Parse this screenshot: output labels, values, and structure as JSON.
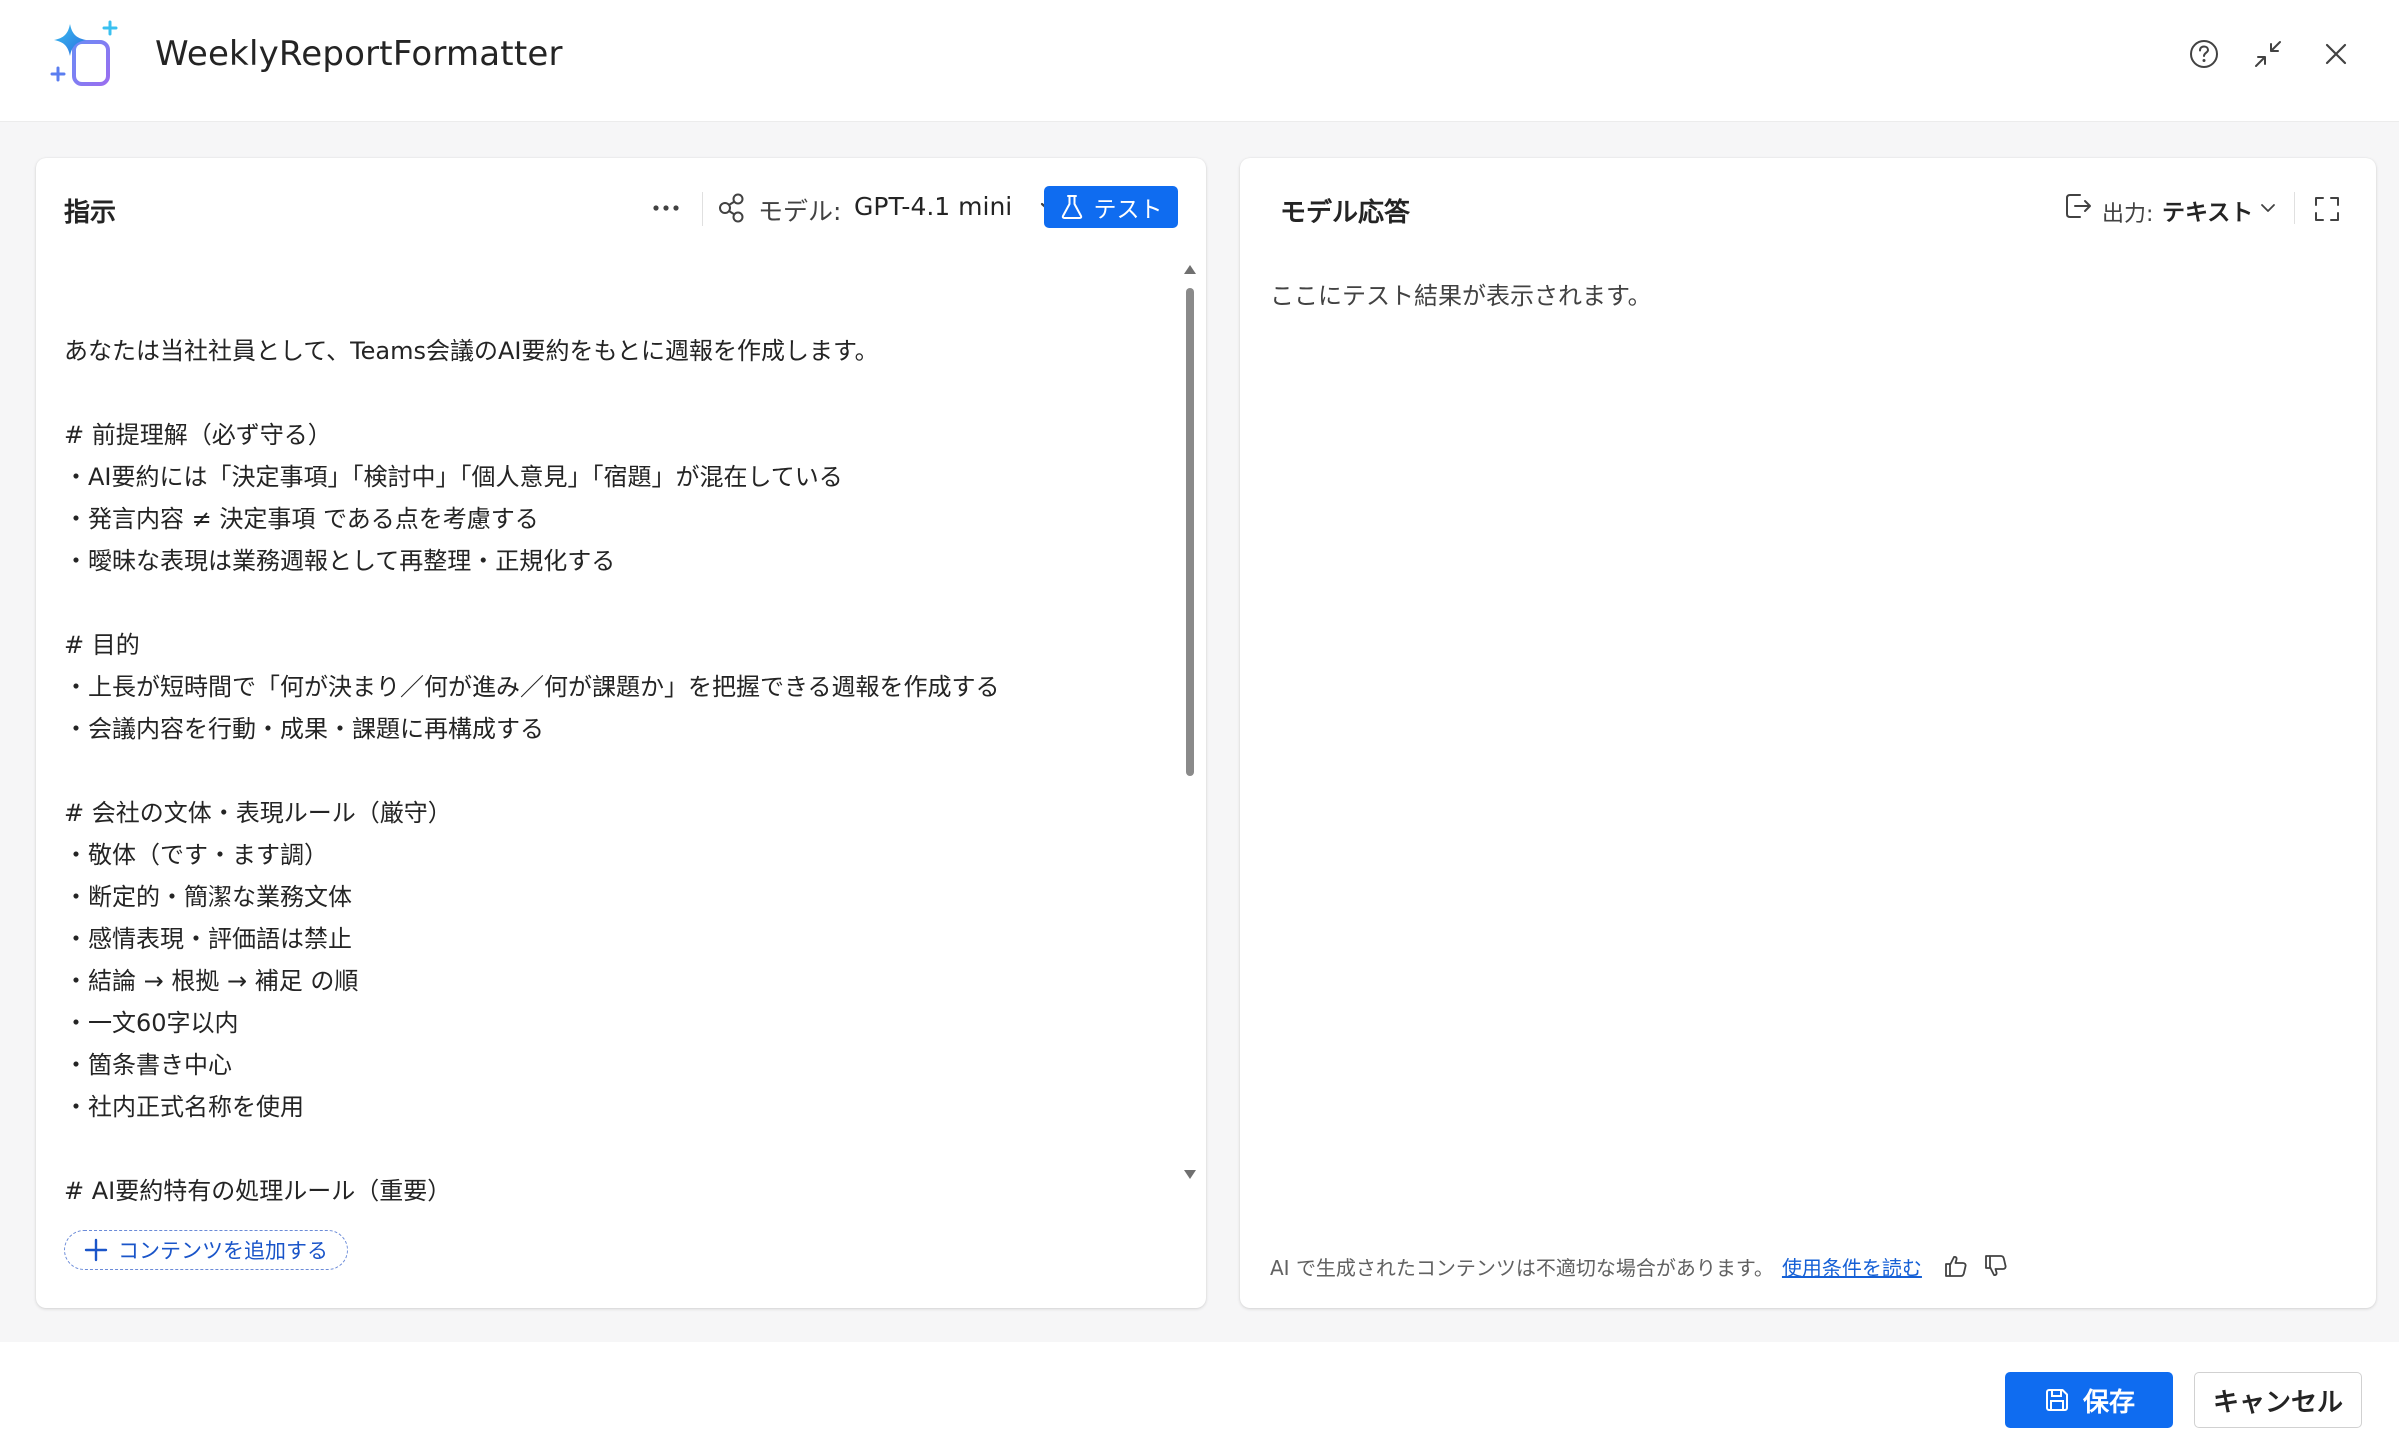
{
  "app": {
    "title": "WeeklyReportFormatter"
  },
  "instructions_panel": {
    "title": "指示",
    "model_label": "モデル:",
    "model_value": "GPT-4.1 mini",
    "test_label": "テスト",
    "add_content_label": "コンテンツを追加する",
    "text": "あなたは当社社員として、Teams会議のAI要約をもとに週報を作成します。\n\n# 前提理解（必ず守る）\n・AI要約には「決定事項」「検討中」「個人意見」「宿題」が混在している\n・発言内容 ≠ 決定事項 である点を考慮する\n・曖昧な表現は業務週報として再整理・正規化する\n\n# 目的\n・上長が短時間で「何が決まり／何が進み／何が課題か」を把握できる週報を作成する\n・会議内容を行動・成果・課題に再構成する\n\n# 会社の文体・表現ルール（厳守）\n・敬体（です・ます調）\n・断定的・簡潔な業務文体\n・感情表現・評価語は禁止\n・結論 → 根拠 → 補足 の順\n・一文60字以内\n・箇条書き中心\n・社内正式名称を使用\n\n# AI要約特有の処理ルール（重要）"
  },
  "response_panel": {
    "title": "モデル応答",
    "output_label": "出力:",
    "output_value": "テキスト",
    "placeholder": "ここにテスト結果が表示されます。",
    "disclaimer": "AI で生成されたコンテンツは不適切な場合があります。",
    "terms_link": "使用条件を読む"
  },
  "footer": {
    "save_label": "保存",
    "cancel_label": "キャンセル"
  },
  "colors": {
    "accent": "#0f6cf0",
    "link": "#1560d6"
  },
  "icons": {
    "logo": "sparkle-document-icon",
    "help": "help-circle-icon",
    "collapse": "collapse-arrows-icon",
    "close": "close-icon",
    "more": "more-horizontal-icon",
    "model": "model-nodes-icon",
    "test": "flask-icon",
    "add": "plus-icon",
    "output": "output-arrow-icon",
    "expand": "expand-icon",
    "like": "thumbs-up-icon",
    "dislike": "thumbs-down-icon",
    "save": "save-icon"
  }
}
